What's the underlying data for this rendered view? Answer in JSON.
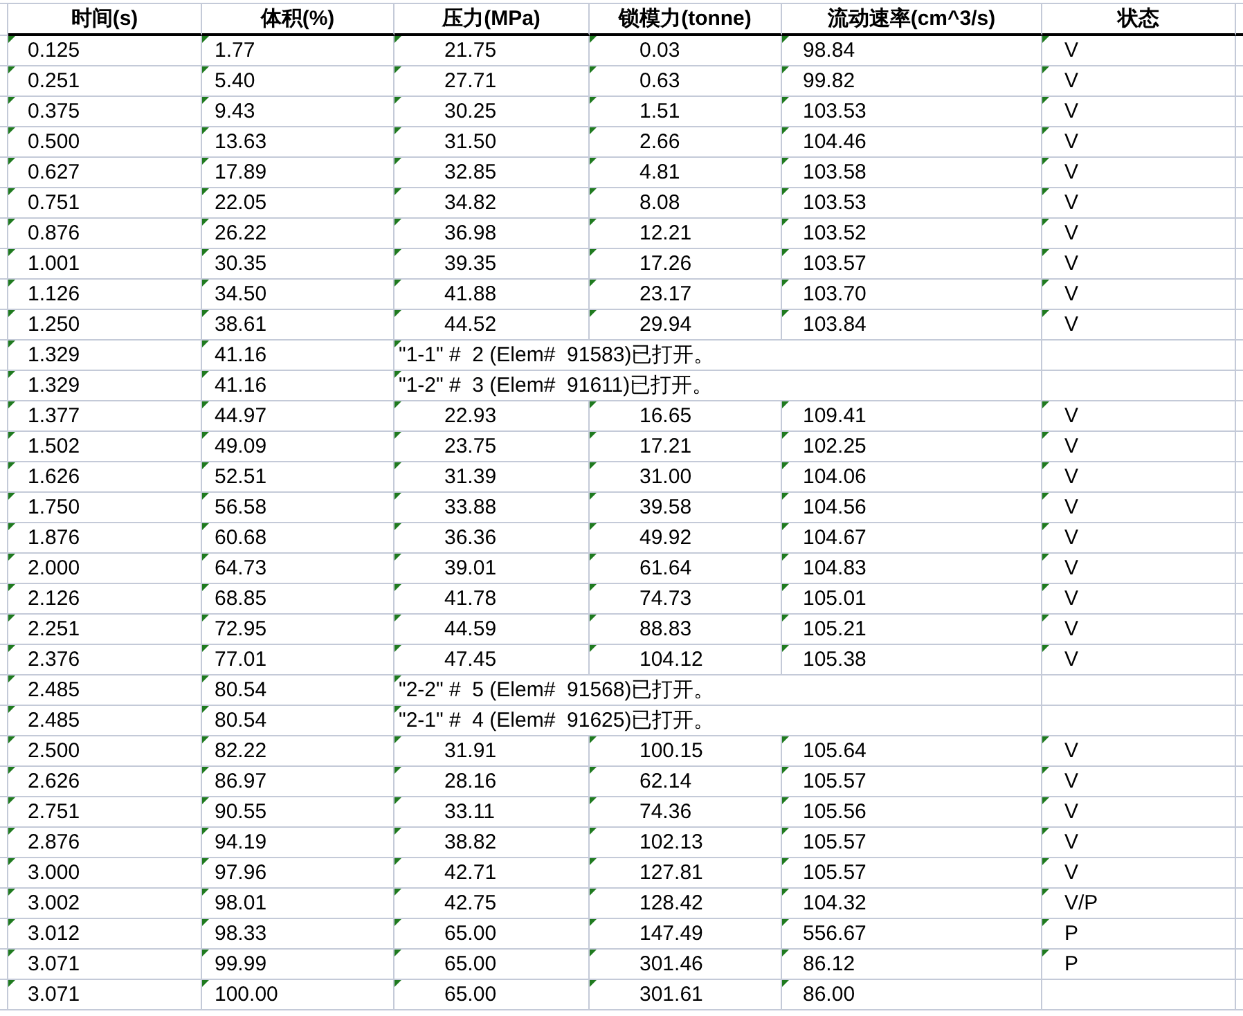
{
  "table": {
    "columns": [
      "时间(s)",
      "体积(%)",
      "压力(MPa)",
      "锁模力(tonne)",
      "流动速率(cm^3/s)",
      "状态"
    ],
    "rows": [
      {
        "kind": "data",
        "cells": [
          "0.125",
          "1.77",
          "21.75",
          "0.03",
          "98.84",
          "V"
        ]
      },
      {
        "kind": "data",
        "cells": [
          "0.251",
          "5.40",
          "27.71",
          "0.63",
          "99.82",
          "V"
        ]
      },
      {
        "kind": "data",
        "cells": [
          "0.375",
          "9.43",
          "30.25",
          "1.51",
          "103.53",
          "V"
        ]
      },
      {
        "kind": "data",
        "cells": [
          "0.500",
          "13.63",
          "31.50",
          "2.66",
          "104.46",
          "V"
        ]
      },
      {
        "kind": "data",
        "cells": [
          "0.627",
          "17.89",
          "32.85",
          "4.81",
          "103.58",
          "V"
        ]
      },
      {
        "kind": "data",
        "cells": [
          "0.751",
          "22.05",
          "34.82",
          "8.08",
          "103.53",
          "V"
        ]
      },
      {
        "kind": "data",
        "cells": [
          "0.876",
          "26.22",
          "36.98",
          "12.21",
          "103.52",
          "V"
        ]
      },
      {
        "kind": "data",
        "cells": [
          "1.001",
          "30.35",
          "39.35",
          "17.26",
          "103.57",
          "V"
        ]
      },
      {
        "kind": "data",
        "cells": [
          "1.126",
          "34.50",
          "41.88",
          "23.17",
          "103.70",
          "V"
        ]
      },
      {
        "kind": "data",
        "cells": [
          "1.250",
          "38.61",
          "44.52",
          "29.94",
          "103.84",
          "V"
        ]
      },
      {
        "kind": "message",
        "cells": [
          "1.329",
          "41.16",
          "\"1-1\" #  2 (Elem#  91583)已打开。"
        ]
      },
      {
        "kind": "message",
        "cells": [
          "1.329",
          "41.16",
          "\"1-2\" #  3 (Elem#  91611)已打开。"
        ]
      },
      {
        "kind": "data",
        "cells": [
          "1.377",
          "44.97",
          "22.93",
          "16.65",
          "109.41",
          "V"
        ]
      },
      {
        "kind": "data",
        "cells": [
          "1.502",
          "49.09",
          "23.75",
          "17.21",
          "102.25",
          "V"
        ]
      },
      {
        "kind": "data",
        "cells": [
          "1.626",
          "52.51",
          "31.39",
          "31.00",
          "104.06",
          "V"
        ]
      },
      {
        "kind": "data",
        "cells": [
          "1.750",
          "56.58",
          "33.88",
          "39.58",
          "104.56",
          "V"
        ]
      },
      {
        "kind": "data",
        "cells": [
          "1.876",
          "60.68",
          "36.36",
          "49.92",
          "104.67",
          "V"
        ]
      },
      {
        "kind": "data",
        "cells": [
          "2.000",
          "64.73",
          "39.01",
          "61.64",
          "104.83",
          "V"
        ]
      },
      {
        "kind": "data",
        "cells": [
          "2.126",
          "68.85",
          "41.78",
          "74.73",
          "105.01",
          "V"
        ]
      },
      {
        "kind": "data",
        "cells": [
          "2.251",
          "72.95",
          "44.59",
          "88.83",
          "105.21",
          "V"
        ]
      },
      {
        "kind": "data",
        "cells": [
          "2.376",
          "77.01",
          "47.45",
          "104.12",
          "105.38",
          "V"
        ]
      },
      {
        "kind": "message",
        "cells": [
          "2.485",
          "80.54",
          "\"2-2\" #  5 (Elem#  91568)已打开。"
        ]
      },
      {
        "kind": "message",
        "cells": [
          "2.485",
          "80.54",
          "\"2-1\" #  4 (Elem#  91625)已打开。"
        ]
      },
      {
        "kind": "data",
        "cells": [
          "2.500",
          "82.22",
          "31.91",
          "100.15",
          "105.64",
          "V"
        ]
      },
      {
        "kind": "data",
        "cells": [
          "2.626",
          "86.97",
          "28.16",
          "62.14",
          "105.57",
          "V"
        ]
      },
      {
        "kind": "data",
        "cells": [
          "2.751",
          "90.55",
          "33.11",
          "74.36",
          "105.56",
          "V"
        ]
      },
      {
        "kind": "data",
        "cells": [
          "2.876",
          "94.19",
          "38.82",
          "102.13",
          "105.57",
          "V"
        ]
      },
      {
        "kind": "data",
        "cells": [
          "3.000",
          "97.96",
          "42.71",
          "127.81",
          "105.57",
          "V"
        ]
      },
      {
        "kind": "data",
        "cells": [
          "3.002",
          "98.01",
          "42.75",
          "128.42",
          "104.32",
          "V/P"
        ]
      },
      {
        "kind": "data",
        "cells": [
          "3.012",
          "98.33",
          "65.00",
          "147.49",
          "556.67",
          "P"
        ]
      },
      {
        "kind": "data",
        "cells": [
          "3.071",
          "99.99",
          "65.00",
          "301.46",
          "86.12",
          "P"
        ]
      },
      {
        "kind": "data",
        "cells": [
          "3.071",
          "100.00",
          "65.00",
          "301.61",
          "86.00",
          ""
        ]
      }
    ]
  }
}
